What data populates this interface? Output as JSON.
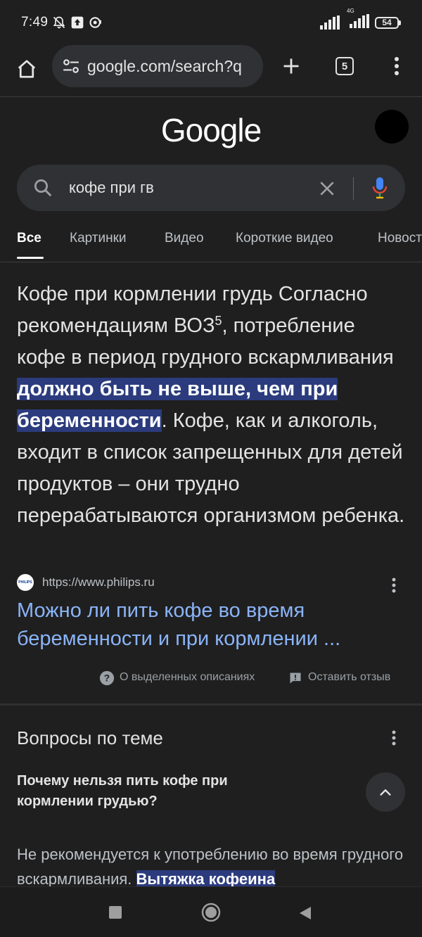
{
  "status": {
    "time": "7:49",
    "network_label": "4G",
    "battery": "54"
  },
  "browser": {
    "url": "google.com/search?q",
    "tab_count": "5"
  },
  "search": {
    "logo": "Google",
    "query": "кофе при гв"
  },
  "filters": [
    {
      "label": "Все",
      "active": true
    },
    {
      "label": "Картинки"
    },
    {
      "label": "Видео"
    },
    {
      "label": "Короткие видео"
    },
    {
      "label": "Новости"
    }
  ],
  "featured": {
    "text_intro": "Кофе при кормлении грудь Согласно рекомендациям ВОЗ",
    "superscript": "5",
    "text_mid": ", потребление кофе в период грудного вскармливания ",
    "highlight": "должно быть не выше, чем при беременности",
    "text_end": ". Кофе, как и алкоголь, входит в список запрещенных для детей продуктов – они трудно перерабатываются организмом ребенка.",
    "source_favicon": "PHILIPS",
    "source_url": "https://www.philips.ru",
    "result_title": "Можно ли пить кофе во время беременности и при кормлении ...",
    "about_label": "О выделенных описаниях",
    "feedback_label": "Оставить отзыв"
  },
  "paa": {
    "title": "Вопросы по теме",
    "question": "Почему нельзя пить кофе при кормлении грудью?",
    "answer_text": "Не рекомендуется к употреблению во время грудного вскармливания. ",
    "answer_highlight": "Вытяжка кофеина"
  },
  "colors": {
    "background": "#1f1f1f",
    "link": "#8ab4f8",
    "highlight": "#2b3b7d"
  }
}
